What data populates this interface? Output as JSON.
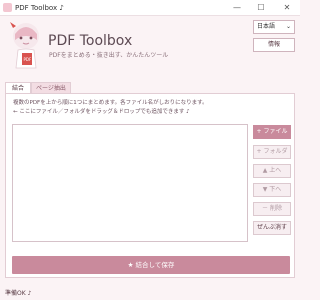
{
  "window": {
    "title": "PDF Toolbox",
    "title_note_glyph": "♪",
    "controls": {
      "minimize": "—",
      "maximize": "☐",
      "close": "✕"
    }
  },
  "header": {
    "app_name": "PDF Toolbox",
    "subtitle": "PDFをまとめる・抜き出す、かんたんツール",
    "mascot_icon": "mascot-girl-holding-pdf"
  },
  "top_right": {
    "language_selected": "日本語",
    "info_label": "情報"
  },
  "tabs": [
    {
      "label": "結合",
      "active": true
    },
    {
      "label": "ページ抽出",
      "active": false
    }
  ],
  "merge_tab": {
    "description_line1": "複数のPDFを上から順に1つにまとめます。各ファイル名がしおりになります。",
    "description_line2": "← ここにファイル／フォルダをドラッグ＆ドロップでも追加できます ♪",
    "side_buttons": {
      "add_file": "+ ファイル",
      "add_folder": "+ フォルダ",
      "move_up": "▲ 上へ",
      "move_down": "▼ 下へ",
      "remove": "－ 削除",
      "clear_all": "ぜんぶ消す"
    },
    "merge_save_label": "★ 結合して保存"
  },
  "status": {
    "text": "準備OK ♪"
  },
  "colors": {
    "accent": "#c98a9c",
    "background": "#fbf3f5",
    "tab_inactive": "#f3dde3"
  }
}
